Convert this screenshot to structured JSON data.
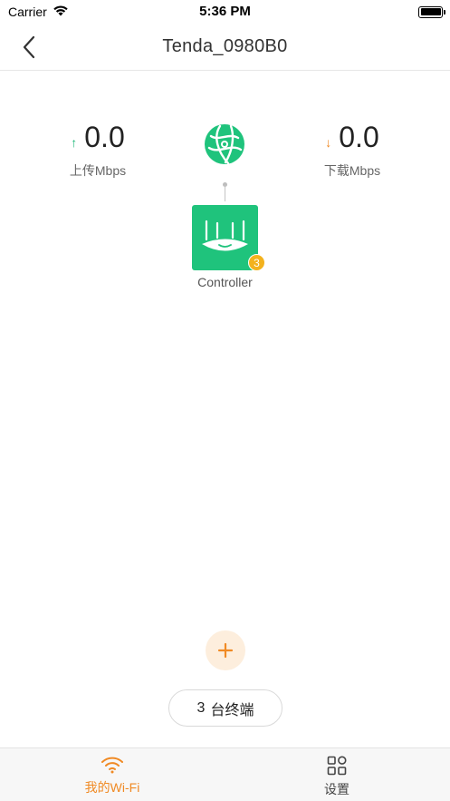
{
  "status_bar": {
    "carrier": "Carrier",
    "time": "5:36 PM"
  },
  "nav": {
    "title": "Tenda_0980B0"
  },
  "upload": {
    "value": "0.0",
    "label": "上传Mbps",
    "arrow": "↑"
  },
  "download": {
    "value": "0.0",
    "label": "下载Mbps",
    "arrow": "↓"
  },
  "router": {
    "label": "Controller",
    "badge_count": "3"
  },
  "terminal_button": {
    "count": "3",
    "label": "台终端"
  },
  "tabs": [
    {
      "label": "我的Wi-Fi",
      "icon": "wifi-icon",
      "active": true
    },
    {
      "label": "设置",
      "icon": "grid-icon",
      "active": false
    }
  ],
  "colors": {
    "accent_orange": "#f08a24",
    "accent_green": "#1fc37c",
    "badge_yellow": "#f3b21d",
    "upload_arrow": "#1fb87a",
    "download_arrow": "#f08a24"
  }
}
